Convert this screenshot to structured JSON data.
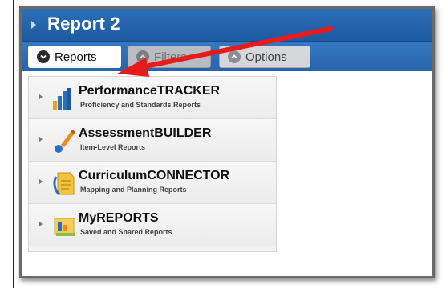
{
  "panel": {
    "title": "Report 2"
  },
  "toolbar": {
    "reports_label": "Reports",
    "filters_label": "Filters",
    "options_label": "Options"
  },
  "menu": {
    "items": [
      {
        "name": "PerformanceTRACKER",
        "subtitle": "Proficiency and Standards Reports",
        "icon": "bar-chart-icon"
      },
      {
        "name": "AssessmentBUILDER",
        "subtitle": "Item-Level Reports",
        "icon": "pencil-icon"
      },
      {
        "name": "CurriculumCONNECTOR",
        "subtitle": "Mapping and Planning Reports",
        "icon": "document-icon"
      },
      {
        "name": "MyREPORTS",
        "subtitle": "Saved and Shared Reports",
        "icon": "folder-icon"
      }
    ]
  },
  "colors": {
    "header_blue": "#1d5aa0",
    "toolbar_blue": "#2764ab",
    "annotation_arrow": "#e81b1b"
  }
}
